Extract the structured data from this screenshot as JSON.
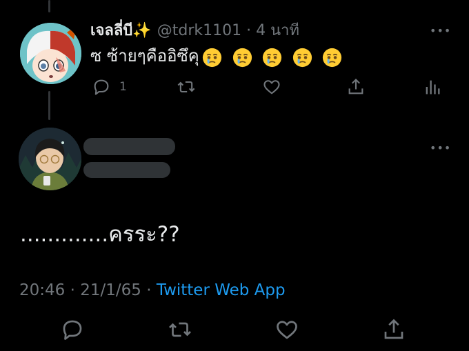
{
  "reply_tweet": {
    "display_name": "เจลลี่บี✨",
    "handle": "@tdrk1101",
    "separator": "·",
    "time_ago": "4 นาที",
    "text": "ซ ซ้ายๆคืออิซึคุ",
    "emojis": [
      "face-holding-back-tears",
      "face-holding-back-tears",
      "face-holding-back-tears",
      "face-holding-back-tears",
      "face-holding-back-tears"
    ],
    "reply_count": "1",
    "more_label": "•••"
  },
  "main_tweet": {
    "text": ".............ครระ??",
    "timestamp": "20:46 · 21/1/65 · ",
    "source": "Twitter Web App",
    "more_label": "•••"
  },
  "colors": {
    "background": "#000000",
    "text": "#e7e9ea",
    "muted": "#71767b",
    "link": "#1d9bf0",
    "redaction": "#2f3336"
  }
}
